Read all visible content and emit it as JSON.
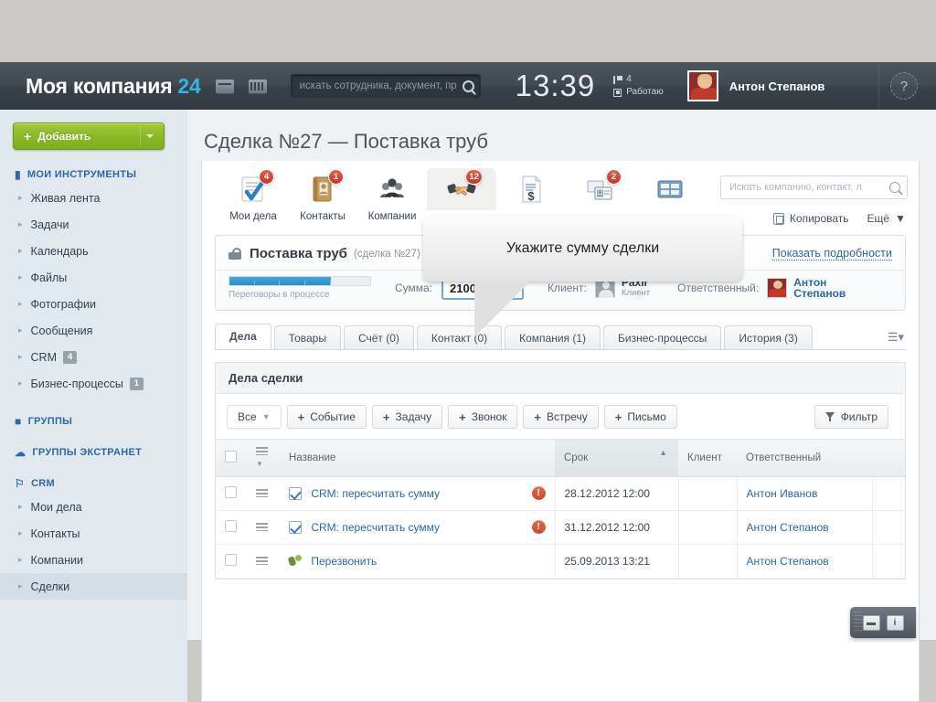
{
  "header": {
    "logo": "Моя компания",
    "logo_num": "24",
    "icons": [
      "messages-icon",
      "grid-icon"
    ],
    "search_placeholder": "искать сотрудника, документ, пр",
    "search_value": "",
    "clock": "13:39",
    "flag_count": "4",
    "work_status": "Работаю",
    "user_name": "Антон Степанов",
    "help_label": "?"
  },
  "sidebar": {
    "add_button": "Добавить",
    "sections": [
      {
        "title": "МОИ ИНСТРУМЕНТЫ",
        "icon": "bookmark-icon",
        "items": [
          {
            "label": "Живая лента",
            "badge": ""
          },
          {
            "label": "Задачи",
            "badge": ""
          },
          {
            "label": "Календарь",
            "badge": ""
          },
          {
            "label": "Файлы",
            "badge": ""
          },
          {
            "label": "Фотографии",
            "badge": ""
          },
          {
            "label": "Сообщения",
            "badge": ""
          },
          {
            "label": "CRM",
            "badge": "4"
          },
          {
            "label": "Бизнес-процессы",
            "badge": "1"
          }
        ]
      },
      {
        "title": "ГРУППЫ",
        "icon": "group-icon",
        "items": []
      },
      {
        "title": "ГРУППЫ ЭКСТРАНЕТ",
        "icon": "cloud-icon",
        "items": []
      },
      {
        "title": "CRM",
        "icon": "flag-icon",
        "items": [
          {
            "label": "Мои дела",
            "badge": ""
          },
          {
            "label": "Контакты",
            "badge": ""
          },
          {
            "label": "Компании",
            "badge": ""
          },
          {
            "label": "Сделки",
            "badge": "",
            "active": true
          }
        ]
      }
    ]
  },
  "page": {
    "title": "Сделка №27 — Поставка труб"
  },
  "crm_toolbar": {
    "tiles": [
      {
        "label": "Мои дела",
        "icon": "task-check-icon",
        "badge": "4",
        "selected": false
      },
      {
        "label": "Контакты",
        "icon": "address-book-icon",
        "badge": "1",
        "selected": false
      },
      {
        "label": "Компании",
        "icon": "company-people-icon",
        "badge": "",
        "selected": false
      },
      {
        "label": "",
        "icon": "handshake-deal-icon",
        "badge": "12",
        "selected": true
      },
      {
        "label": "",
        "icon": "invoice-dollar-icon",
        "badge": "",
        "selected": false
      },
      {
        "label": "",
        "icon": "leads-card-icon",
        "badge": "2",
        "selected": false
      },
      {
        "label": "",
        "icon": "reports-grid-icon",
        "badge": "",
        "selected": false
      }
    ],
    "search_placeholder": "Искать компанию, контакт, л",
    "search_value": ""
  },
  "callout": {
    "text": "Укажите сумму сделки"
  },
  "actions": {
    "copy": "Копировать",
    "more": "Ещё"
  },
  "deal": {
    "title": "Поставка труб",
    "subtitle": "(сделка №27)",
    "details_link": "Показать подробности",
    "stage_label": "Переговоры в процессе",
    "progress_percent": 72,
    "sum_label": "Сумма:",
    "sum_value": "210000.00",
    "client_label": "Клиент:",
    "client_name": "Paxir",
    "client_role": "Клиент",
    "responsible_label": "Ответственный:",
    "responsible_name_1": "Антон",
    "responsible_name_2": "Степанов"
  },
  "tabs": [
    {
      "label": "Дела",
      "active": true
    },
    {
      "label": "Товары",
      "active": false
    },
    {
      "label": "Счёт (0)",
      "active": false
    },
    {
      "label": "Контакт (0)",
      "active": false
    },
    {
      "label": "Компания (1)",
      "active": false
    },
    {
      "label": "Бизнес-процессы",
      "active": false
    },
    {
      "label": "История (3)",
      "active": false
    }
  ],
  "section": {
    "heading": "Дела сделки",
    "filter_dropdown": "Все",
    "buttons": [
      {
        "label": "Событие"
      },
      {
        "label": "Задачу"
      },
      {
        "label": "Звонок"
      },
      {
        "label": "Встречу"
      },
      {
        "label": "Письмо"
      }
    ],
    "filter_button": "Фильтр"
  },
  "table": {
    "columns": [
      "Название",
      "Срок",
      "Клиент",
      "Ответственный"
    ],
    "sorted_column": "Срок",
    "rows": [
      {
        "name": "CRM: пересчитать сумму",
        "icon": "task-check-icon",
        "alert": "!",
        "date": "28.12.2012 12:00",
        "client": "",
        "responsible": "Антон Иванов"
      },
      {
        "name": "CRM: пересчитать сумму",
        "icon": "task-check-icon",
        "alert": "!",
        "date": "31.12.2012 12:00",
        "client": "",
        "responsible": "Антон Степанов"
      },
      {
        "name": "Перезвонить",
        "icon": "phone-icon",
        "alert": "",
        "date": "25.09.2013 13:21",
        "client": "",
        "responsible": "Антон Степанов"
      }
    ]
  },
  "float_widget": {
    "chat_icon": "chat-icon",
    "info_icon": "info-icon"
  }
}
